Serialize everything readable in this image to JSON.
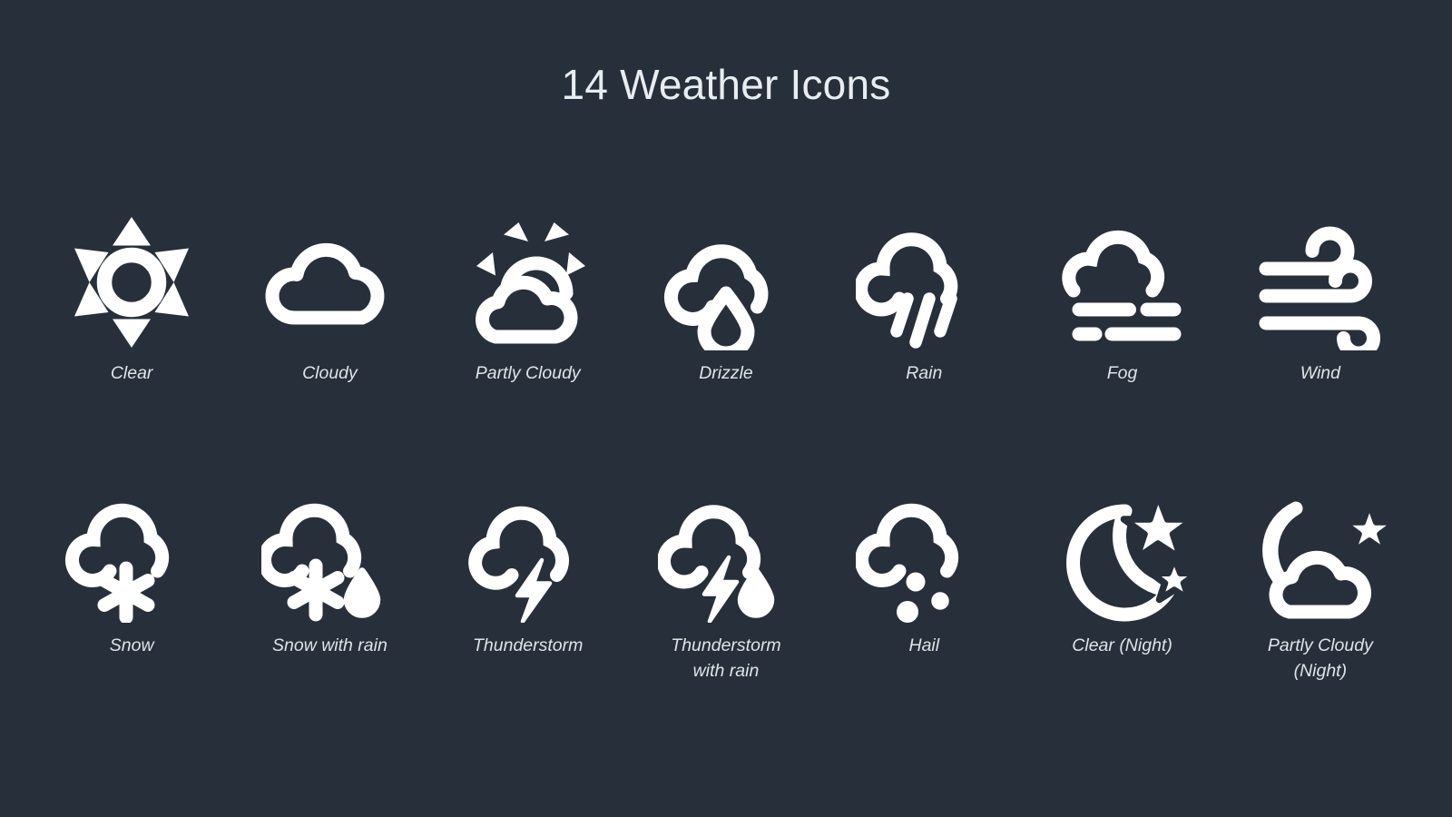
{
  "page": {
    "title": "14 Weather Icons",
    "background_color": "#272f3a",
    "icon_color": "#ffffff",
    "label_color": "#dfe4e9",
    "title_color": "#e9edf1"
  },
  "icons": [
    {
      "id": "clear",
      "label": "Clear",
      "glyph": "sun-icon"
    },
    {
      "id": "cloudy",
      "label": "Cloudy",
      "glyph": "cloud-icon"
    },
    {
      "id": "partly-cloudy",
      "label": "Partly Cloudy",
      "glyph": "sun-behind-cloud-icon"
    },
    {
      "id": "drizzle",
      "label": "Drizzle",
      "glyph": "cloud-with-droplet-icon"
    },
    {
      "id": "rain",
      "label": "Rain",
      "glyph": "cloud-with-rain-lines-icon"
    },
    {
      "id": "fog",
      "label": "Fog",
      "glyph": "cloud-with-fog-bars-icon"
    },
    {
      "id": "wind",
      "label": "Wind",
      "glyph": "wind-curls-icon"
    },
    {
      "id": "snow",
      "label": "Snow",
      "glyph": "cloud-with-snowflake-icon"
    },
    {
      "id": "snow-with-rain",
      "label": "Snow with rain",
      "glyph": "cloud-with-snowflake-and-droplet-icon"
    },
    {
      "id": "thunderstorm",
      "label": "Thunderstorm",
      "glyph": "cloud-with-lightning-icon"
    },
    {
      "id": "thunderstorm-with-rain",
      "label": "Thunderstorm\nwith rain",
      "glyph": "cloud-with-lightning-and-droplet-icon"
    },
    {
      "id": "hail",
      "label": "Hail",
      "glyph": "cloud-with-hail-dots-icon"
    },
    {
      "id": "clear-night",
      "label": "Clear (Night)",
      "glyph": "moon-with-stars-icon"
    },
    {
      "id": "partly-cloudy-night",
      "label": "Partly Cloudy\n(Night)",
      "glyph": "moon-behind-cloud-with-star-icon"
    }
  ]
}
